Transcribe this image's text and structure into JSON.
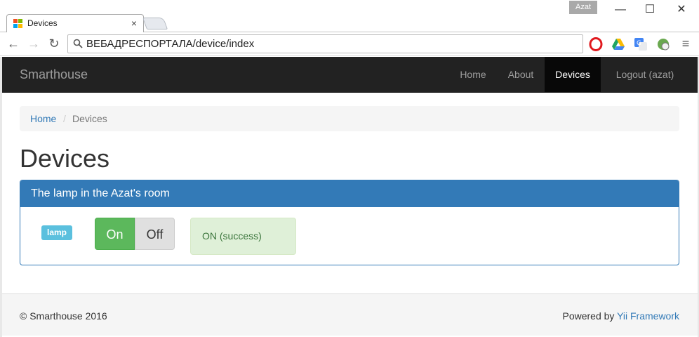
{
  "browser": {
    "tab_title": "Devices",
    "tab_close": "×",
    "profile_name": "Azat",
    "minimize": "—",
    "maximize": "☐",
    "close": "✕",
    "back": "←",
    "forward": "→",
    "reload": "↻",
    "address": "ВЕБАДРЕСПОРТАЛА/device/index",
    "menu": "≡"
  },
  "navbar": {
    "brand": "Smarthouse",
    "items": [
      {
        "label": "Home"
      },
      {
        "label": "About"
      },
      {
        "label": "Devices",
        "active": true
      },
      {
        "label": "Logout (azat)"
      }
    ]
  },
  "breadcrumb": {
    "home": "Home",
    "separator": "/",
    "current": "Devices"
  },
  "page_title": "Devices",
  "device_panel": {
    "heading": "The lamp in the Azat's room",
    "device_label": "lamp",
    "on_label": "On",
    "off_label": "Off",
    "status": "ON (success)"
  },
  "footer": {
    "copyright": "© Smarthouse 2016",
    "powered_prefix": "Powered by",
    "powered_link": "Yii Framework"
  },
  "colors": {
    "primary": "#337ab7",
    "success": "#5cb85c",
    "info": "#5bc0de",
    "navbar": "#222222"
  }
}
